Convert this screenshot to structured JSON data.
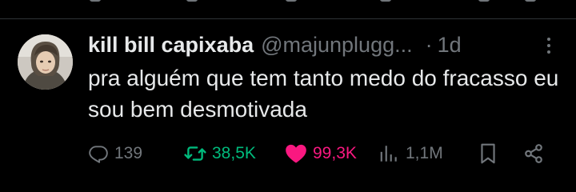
{
  "tweet": {
    "display_name": "kill bill capixaba",
    "handle": "@majunplugg...",
    "separator": "·",
    "time": "1d",
    "text": "pra alguém que tem tanto medo do fracasso eu sou bem desmotivada",
    "metrics": {
      "replies": "139",
      "retweets": "38,5K",
      "likes": "99,3K",
      "views": "1,1M"
    },
    "state": {
      "retweeted": true,
      "liked": true
    }
  },
  "colors": {
    "background": "#000000",
    "text": "#e7e9ea",
    "secondary": "#71767b",
    "retweet": "#00ba7c",
    "like": "#f91880",
    "divider": "#2f3336"
  },
  "icons": [
    "reply-icon",
    "retweet-icon",
    "heart-icon",
    "views-icon",
    "bookmark-icon",
    "share-icon",
    "more-icon"
  ]
}
